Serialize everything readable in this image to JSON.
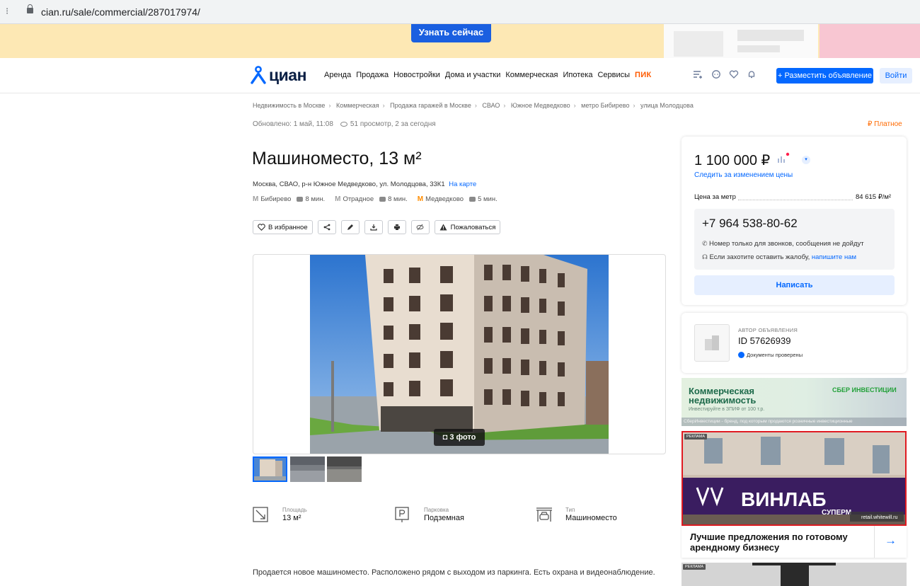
{
  "browser": {
    "url": "cian.ru/sale/commercial/287017974/"
  },
  "promo": {
    "cta_label": "Узнать сейчас"
  },
  "header": {
    "logo_text": "циан",
    "nav": [
      "Аренда",
      "Продажа",
      "Новостройки",
      "Дома и участки",
      "Коммерческая",
      "Ипотека",
      "Сервисы",
      "ПИК"
    ],
    "post_ad_label": "+ Разместить объявление",
    "login_label": "Войти"
  },
  "breadcrumbs": [
    "Недвижимость в Москве",
    "Коммерческая",
    "Продажа гаражей в Москве",
    "СВАО",
    "Южное Медведково",
    "метро Бибирево",
    "улица Молодцова"
  ],
  "meta": {
    "updated": "Обновлено: 1 май, 11:08",
    "views": "51 просмотр, 2 за сегодня",
    "paid_label": "₽ Платное"
  },
  "listing": {
    "title": "Машиноместо, 13 м²",
    "address": "Москва, СВАО, р-н Южное Медведково, ул. Молодцова, 33К1",
    "map_link": "На карте",
    "metro": [
      {
        "station": "Бибирево",
        "time": "8 мин."
      },
      {
        "station": "Отрадное",
        "time": "8 мин."
      },
      {
        "station": "Медведково",
        "time": "5 мин."
      }
    ],
    "favorite_label": "В избранное",
    "complain_label": "Пожаловаться",
    "photo_badge": "3 фото",
    "features": [
      {
        "label": "Площадь",
        "value": "13 м²"
      },
      {
        "label": "Парковка",
        "value": "Подземная"
      },
      {
        "label": "Тип",
        "value": "Машиноместо"
      }
    ],
    "description": "Продается новое машиноместо. Расположено рядом с выходом из паркинга. Есть охрана и видеонаблюдение."
  },
  "price_card": {
    "price": "1 100 000 ₽",
    "follow_label": "Следить за изменением цены",
    "price_per_meter_label": "Цена за метр",
    "price_per_meter_value": "84 615 ₽/м²",
    "phone": "+7 964 538-80-62",
    "note_calls": "Номер только для звонков, сообщения не дойдут",
    "note_complain": "Если захотите оставить жалобу,",
    "note_complain_link": "напишите нам",
    "write_label": "Написать"
  },
  "author": {
    "label": "АВТОР ОБЪЯВЛЕНИЯ",
    "id": "ID 57626939",
    "verified": "Документы проверены"
  },
  "ads": {
    "sber_title_1": "Коммерческая",
    "sber_title_2": "недвижимость",
    "sber_sub": "Инвестируйте в ЗПИФ от 100 т.р.",
    "sber_brand": "СБЕР ИНВЕСТИЦИИ",
    "sber_footer": "СберИнвестиции - бренд, под которым продаются розничные инвестиционные",
    "ad_tag": "РЕКЛАМА",
    "vinlab_sign": "ВИНЛАБ",
    "vinlab_sub": "СУПЕРМ",
    "vinlab_watermark": "retail.whitewill.ru",
    "vinlab_caption": "Лучшие предложения по готовому арендному бизнесу"
  },
  "colors": {
    "accent": "#0468ff",
    "paid": "#ff6a00",
    "pik": "#ff5a00",
    "promo_bg": "#fde8b4"
  }
}
